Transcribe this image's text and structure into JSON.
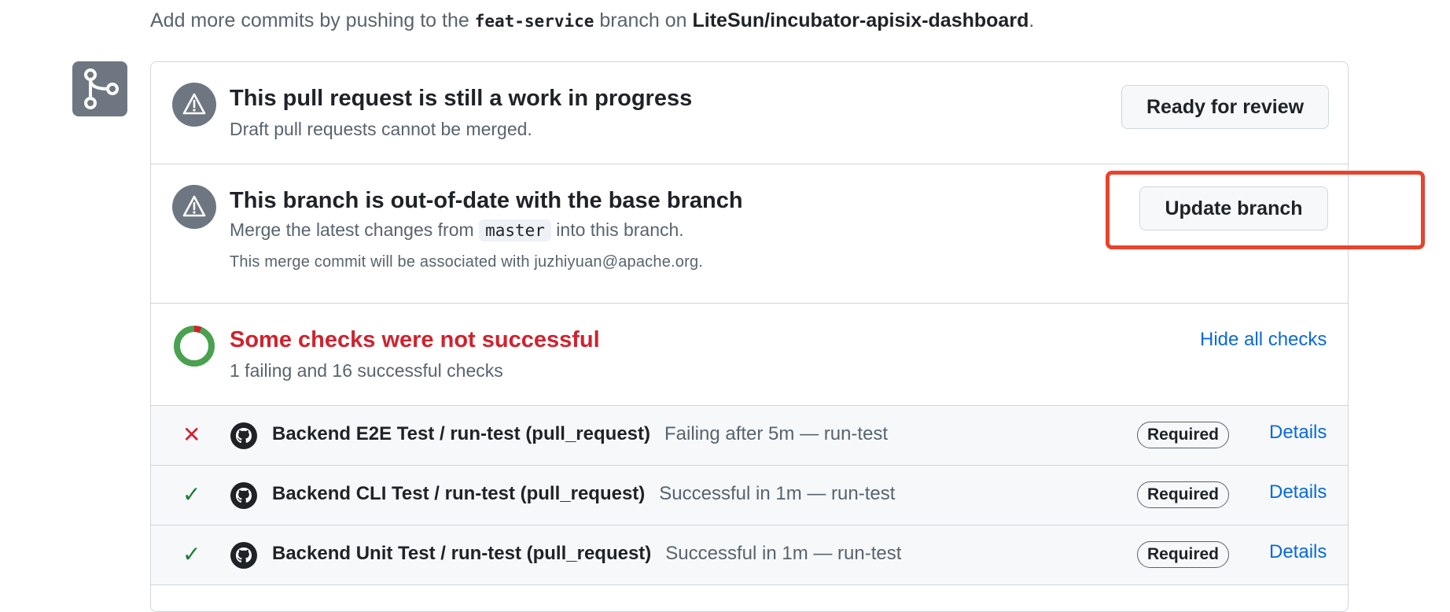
{
  "intro": {
    "prefix": "Add more commits by pushing to the ",
    "branch": "feat-service",
    "middle": " branch on ",
    "repo": "LiteSun/incubator-apisix-dashboard",
    "suffix": "."
  },
  "draft": {
    "title": "This pull request is still a work in progress",
    "subtitle": "Draft pull requests cannot be merged.",
    "button": "Ready for review"
  },
  "outdated": {
    "title": "This branch is out-of-date with the base branch",
    "line_prefix": "Merge the latest changes from ",
    "base_branch": "master",
    "line_suffix": " into this branch.",
    "note": "This merge commit will be associated with juzhiyuan@apache.org.",
    "button": "Update branch"
  },
  "checks": {
    "title": "Some checks were not successful",
    "subtitle": "1 failing and 16 successful checks",
    "toggle_label": "Hide all checks",
    "failing": 1,
    "successful": 16,
    "colors": {
      "fail": "#cf222e",
      "success": "#1a7f37",
      "ring": "#4aa14f"
    },
    "items": [
      {
        "status": "fail",
        "icon": "x-icon",
        "name": "Backend E2E Test / run-test (pull_request)",
        "desc": "Failing after 5m — run-test",
        "badge": "Required",
        "link": "Details"
      },
      {
        "status": "success",
        "icon": "check-icon",
        "name": "Backend CLI Test / run-test (pull_request)",
        "desc": "Successful in 1m — run-test",
        "badge": "Required",
        "link": "Details"
      },
      {
        "status": "success",
        "icon": "check-icon",
        "name": "Backend Unit Test / run-test (pull_request)",
        "desc": "Successful in 1m — run-test",
        "badge": "Required",
        "link": "Details"
      }
    ]
  }
}
